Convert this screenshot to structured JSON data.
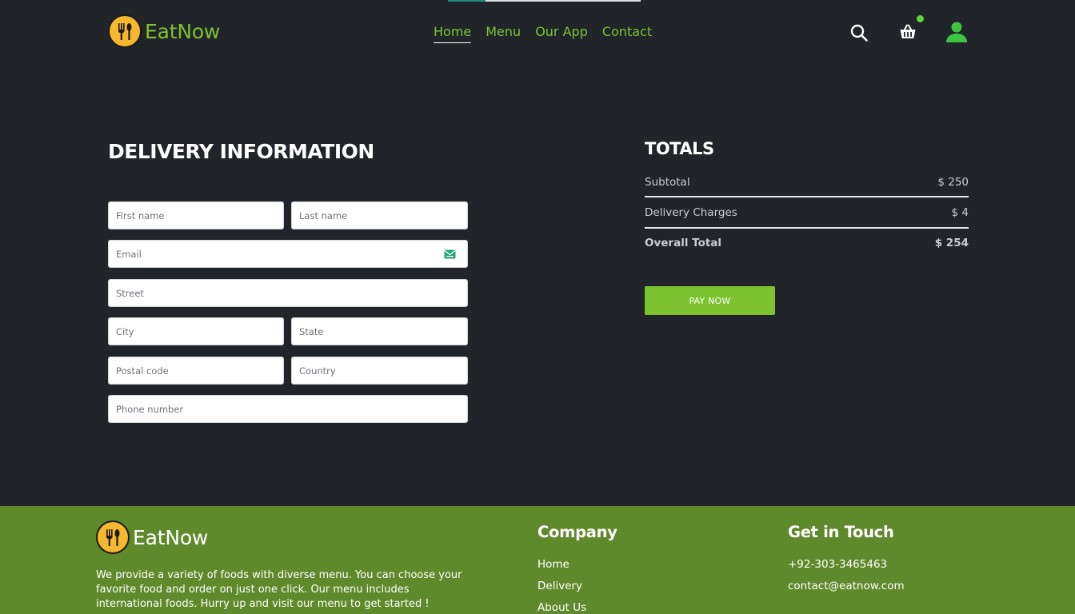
{
  "brand": {
    "name": "EatNow"
  },
  "nav": [
    {
      "label": "Home",
      "active": true
    },
    {
      "label": "Menu",
      "active": false
    },
    {
      "label": "Our App",
      "active": false
    },
    {
      "label": "Contact",
      "active": false
    }
  ],
  "header_icons": {
    "search": "search-icon",
    "cart": "basket-icon",
    "profile": "user-icon"
  },
  "delivery": {
    "title": "DELIVERY INFORMATION",
    "placeholders": {
      "first_name": "First name",
      "last_name": "Last name",
      "email": "Email",
      "street": "Street",
      "city": "City",
      "state": "State",
      "postal_code": "Postal code",
      "country": "Country",
      "phone": "Phone number"
    }
  },
  "totals": {
    "title": "TOTALS",
    "subtotal_label": "Subtotal",
    "subtotal_value": "$ 250",
    "delivery_label": "Delivery Charges",
    "delivery_value": "$ 4",
    "overall_label": "Overall Total",
    "overall_value": "$ 254",
    "pay_label": "PAY NOW"
  },
  "footer": {
    "brand": "EatNow",
    "description": "We provide a variety of foods with diverse menu. You can choose your favorite food and order on just one click. Our menu includes international foods. Hurry up and visit our menu to get started !",
    "company_title": "Company",
    "company_links": [
      "Home",
      "Delivery",
      "About Us"
    ],
    "contact_title": "Get in Touch",
    "phone": "+92-303-3465463",
    "email": "contact@eatnow.com"
  },
  "colors": {
    "background": "#212529",
    "accent_green": "#7dc22f",
    "footer_green": "#5f8a2c",
    "logo_yellow": "#f5b82e"
  }
}
